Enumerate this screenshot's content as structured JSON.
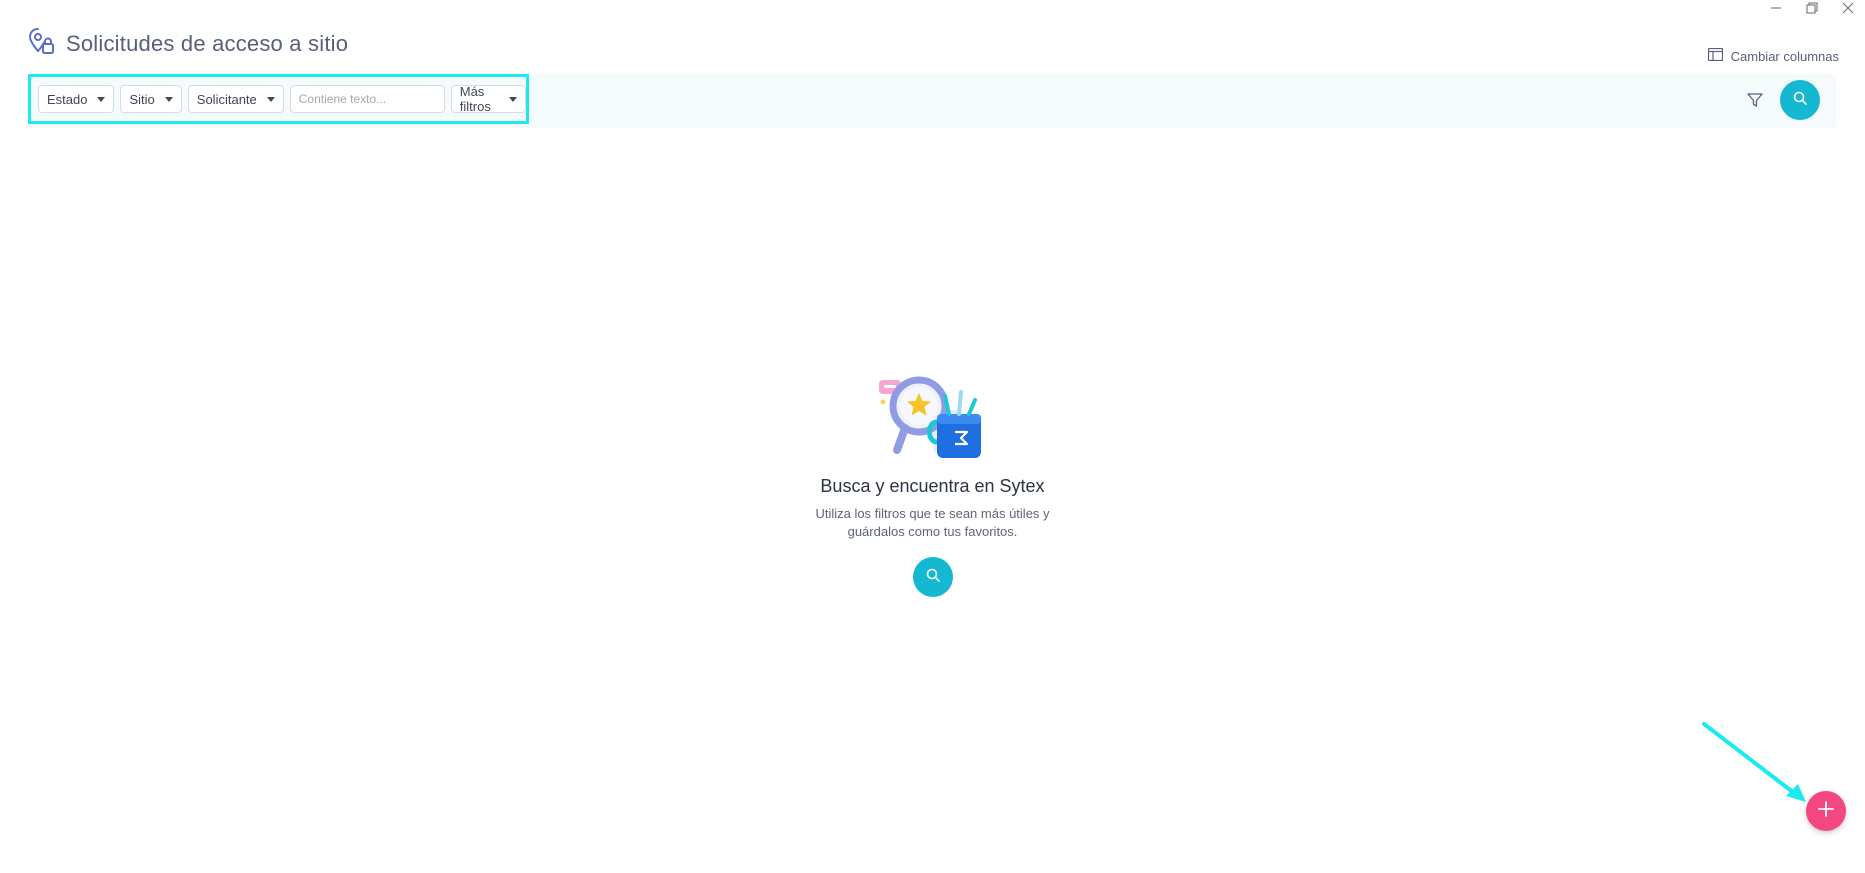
{
  "window": {
    "minimize_icon": "minimize-icon",
    "restore_icon": "restore-icon",
    "close_icon": "close-icon"
  },
  "header": {
    "title": "Solicitudes de acceso a sitio",
    "icon": "location-lock-icon"
  },
  "toolbar": {
    "change_columns_label": "Cambiar columnas",
    "change_columns_icon": "columns-icon"
  },
  "filters": {
    "estado_label": "Estado",
    "sitio_label": "Sitio",
    "solicitante_label": "Solicitante",
    "text_placeholder": "Contiene texto...",
    "more_filters_label": "Más filtros"
  },
  "empty_state": {
    "title": "Busca y encuentra en Sytex",
    "description": "Utiliza los filtros que te sean más útiles y guárdalos como tus favoritos."
  },
  "colors": {
    "accent": "#14b8d0",
    "fab": "#f3477f",
    "highlight": "#1de9f0"
  }
}
